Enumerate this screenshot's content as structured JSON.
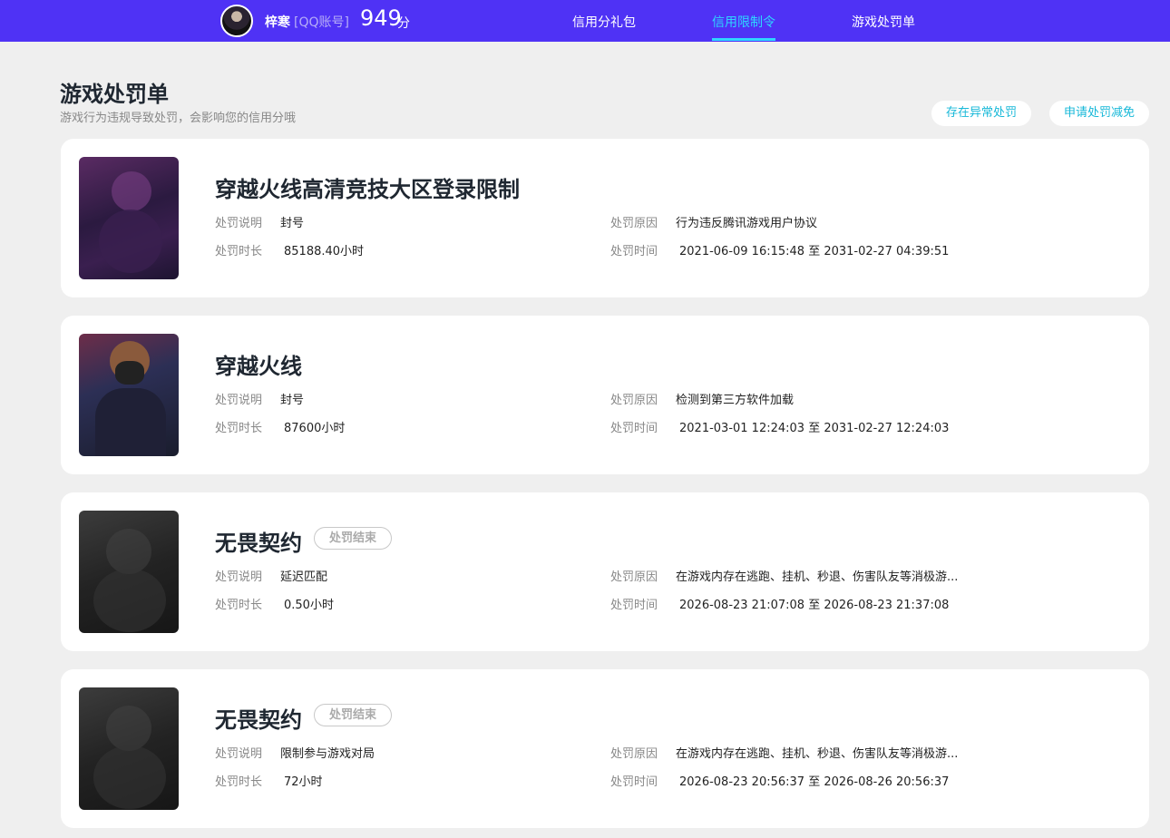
{
  "header": {
    "username": "梓寒",
    "account_type": "[QQ账号]",
    "score": "949",
    "score_unit": "分",
    "nav": [
      {
        "label": "信用分礼包",
        "active": false
      },
      {
        "label": "信用限制令",
        "active": true
      },
      {
        "label": "游戏处罚单",
        "active": false
      }
    ],
    "accent_color": "#4f32f5",
    "active_color": "#2ed6ff"
  },
  "page": {
    "title": "游戏处罚单",
    "subtitle": "游戏行为违规导致处罚，会影响您的信用分哦",
    "buttons": {
      "abnormal": "存在异常处罚",
      "appeal": "申请处罚减免"
    }
  },
  "labels": {
    "description": "处罚说明",
    "duration": "处罚时长",
    "reason": "处罚原因",
    "time": "处罚时间"
  },
  "records": [
    {
      "game": "穿越火线高清竞技大区登录限制",
      "badge": "",
      "description": "封号",
      "duration": "85188.40小时",
      "reason": "行为违反腾讯游戏用户协议",
      "time": "2021-06-09 16:15:48 至 2031-02-27 04:39:51",
      "thumb_icon": "game-art-icon"
    },
    {
      "game": "穿越火线",
      "badge": "",
      "description": "封号",
      "duration": "87600小时",
      "reason": "检测到第三方软件加载",
      "time": "2021-03-01 12:24:03 至 2031-02-27 12:24:03",
      "thumb_icon": "soldier-art-icon"
    },
    {
      "game": "无畏契约",
      "badge": "处罚结束",
      "description": "延迟匹配",
      "duration": "0.50小时",
      "reason": "在游戏内存在逃跑、挂机、秒退、伤害队友等消极游...",
      "time": "2026-08-23 21:07:08 至 2026-08-23 21:37:08",
      "thumb_icon": "game-art-icon"
    },
    {
      "game": "无畏契约",
      "badge": "处罚结束",
      "description": "限制参与游戏对局",
      "duration": "72小时",
      "reason": "在游戏内存在逃跑、挂机、秒退、伤害队友等消极游...",
      "time": "2026-08-23 20:56:37 至 2026-08-26 20:56:37",
      "thumb_icon": "game-art-icon"
    }
  ]
}
